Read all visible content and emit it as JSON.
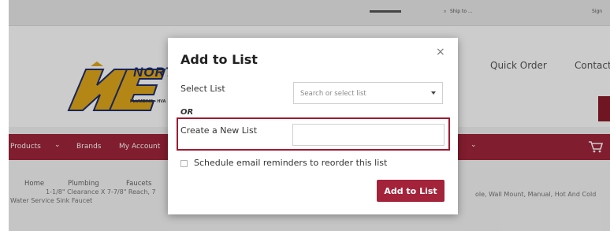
{
  "topbar": {
    "account_text": "",
    "location_text": "Ship to ...",
    "sign_in_text": "Sign"
  },
  "header": {
    "logo_text": "NORT",
    "logo_sub": "PLUMBING • HVA",
    "quick_order": "Quick Order",
    "contact": "Contact"
  },
  "nav": {
    "items": [
      "Products",
      "Brands",
      "My Account"
    ]
  },
  "breadcrumb": {
    "items": [
      "Home",
      "Plumbing",
      "Faucets"
    ]
  },
  "product": {
    "line1": "1-1/8\" Clearance X 7-7/8\" Reach, 7",
    "line2": "Water Service Sink Faucet",
    "line1_right": "ole, Wall Mount, Manual, Hot And Cold"
  },
  "modal": {
    "title": "Add to List",
    "close_symbol": "×",
    "select_label": "Select List",
    "select_placeholder": "Search or select list",
    "or_label": "OR",
    "new_list_label": "Create a New List",
    "new_list_value": "",
    "new_list_placeholder": "",
    "reminder_label": "Schedule email reminders to reorder this list",
    "reminder_checked": false,
    "submit_label": "Add to List"
  },
  "colors": {
    "accent": "#a3233a",
    "nav_bg": "#a0253a",
    "brand_blue": "#1e2f6e",
    "brand_gold": "#e0a81c"
  }
}
